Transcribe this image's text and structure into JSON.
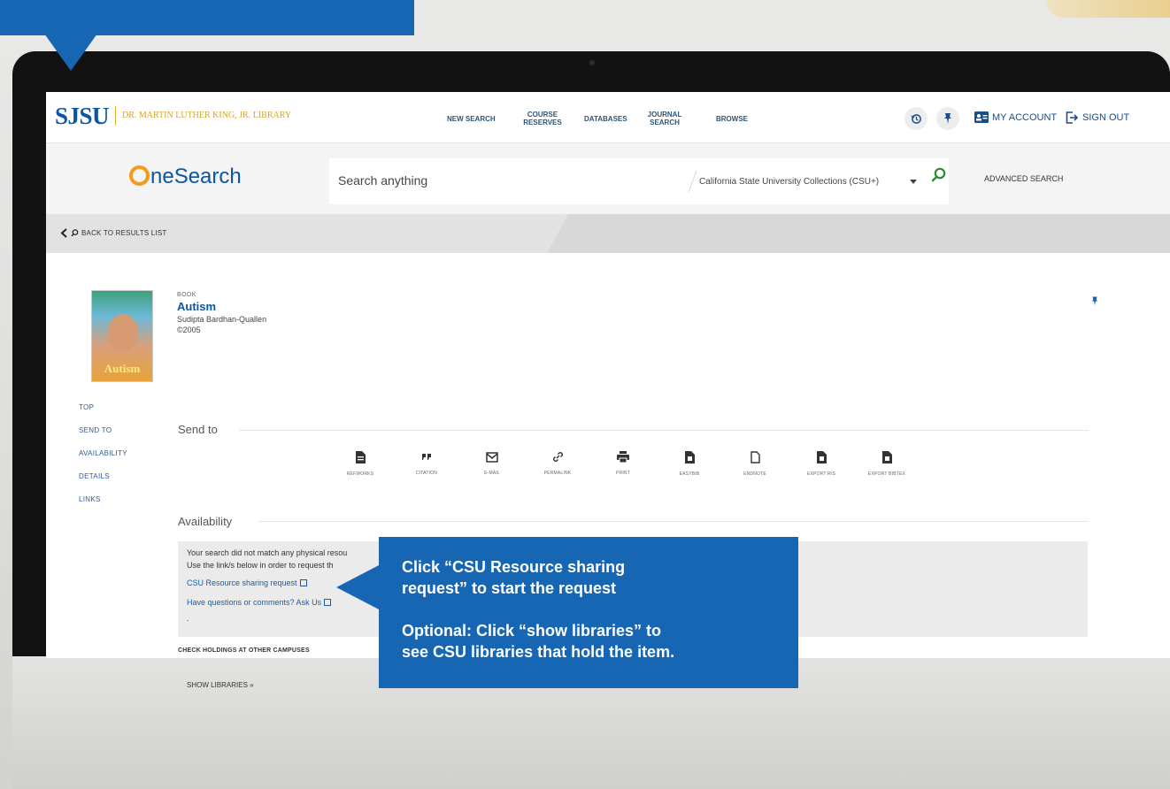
{
  "header": {
    "logo": "SJSU",
    "library_name": "DR. MARTIN LUTHER KING, JR. LIBRARY",
    "nav": [
      "NEW SEARCH",
      "COURSE RESERVES",
      "DATABASES",
      "JOURNAL SEARCH",
      "BROWSE"
    ],
    "my_account": "MY ACCOUNT",
    "sign_out": "SIGN OUT",
    "icons": [
      "history-icon",
      "pin-icon",
      "account-card-icon",
      "sign-out-icon"
    ]
  },
  "search": {
    "brand_rest": "neSearch",
    "placeholder": "Search anything",
    "scope": "California State University Collections (CSU+)",
    "advanced": "ADVANCED SEARCH"
  },
  "back_link": "BACK TO RESULTS LIST",
  "record": {
    "type": "BOOK",
    "title": "Autism",
    "author": "Sudipta Bardhan-Quallen",
    "date": "©2005",
    "cover_title": "Autism"
  },
  "side_nav": [
    "TOP",
    "SEND TO",
    "AVAILABILITY",
    "DETAILS",
    "LINKS"
  ],
  "send_to": {
    "title": "Send to",
    "actions": [
      "REFWORKS",
      "CITATION",
      "E-MAIL",
      "PERMALINK",
      "PRINT",
      "EASYBIB",
      "ENDNOTE",
      "EXPORT RIS",
      "EXPORT BIBTEX"
    ]
  },
  "availability": {
    "title": "Availability",
    "line1": "Your search did not match any physical resou",
    "line2": "Use the link/s below in order to request th",
    "link1": "CSU Resource sharing request",
    "link2": "Have questions or comments? Ask Us",
    "dot": "."
  },
  "holdings": {
    "title": "CHECK HOLDINGS AT OTHER CAMPUSES",
    "show": "SHOW LIBRARIES »"
  },
  "callout": {
    "line1": "Click “CSU Resource sharing",
    "line2": "request” to start the request",
    "line3": "Optional: Click “show libraries” to",
    "line4": "see CSU libraries that hold the item."
  },
  "colors": {
    "brand_blue": "#0b55a3",
    "callout_blue": "#1666b3",
    "gold": "#d5a52b",
    "orange": "#f19b1f"
  }
}
